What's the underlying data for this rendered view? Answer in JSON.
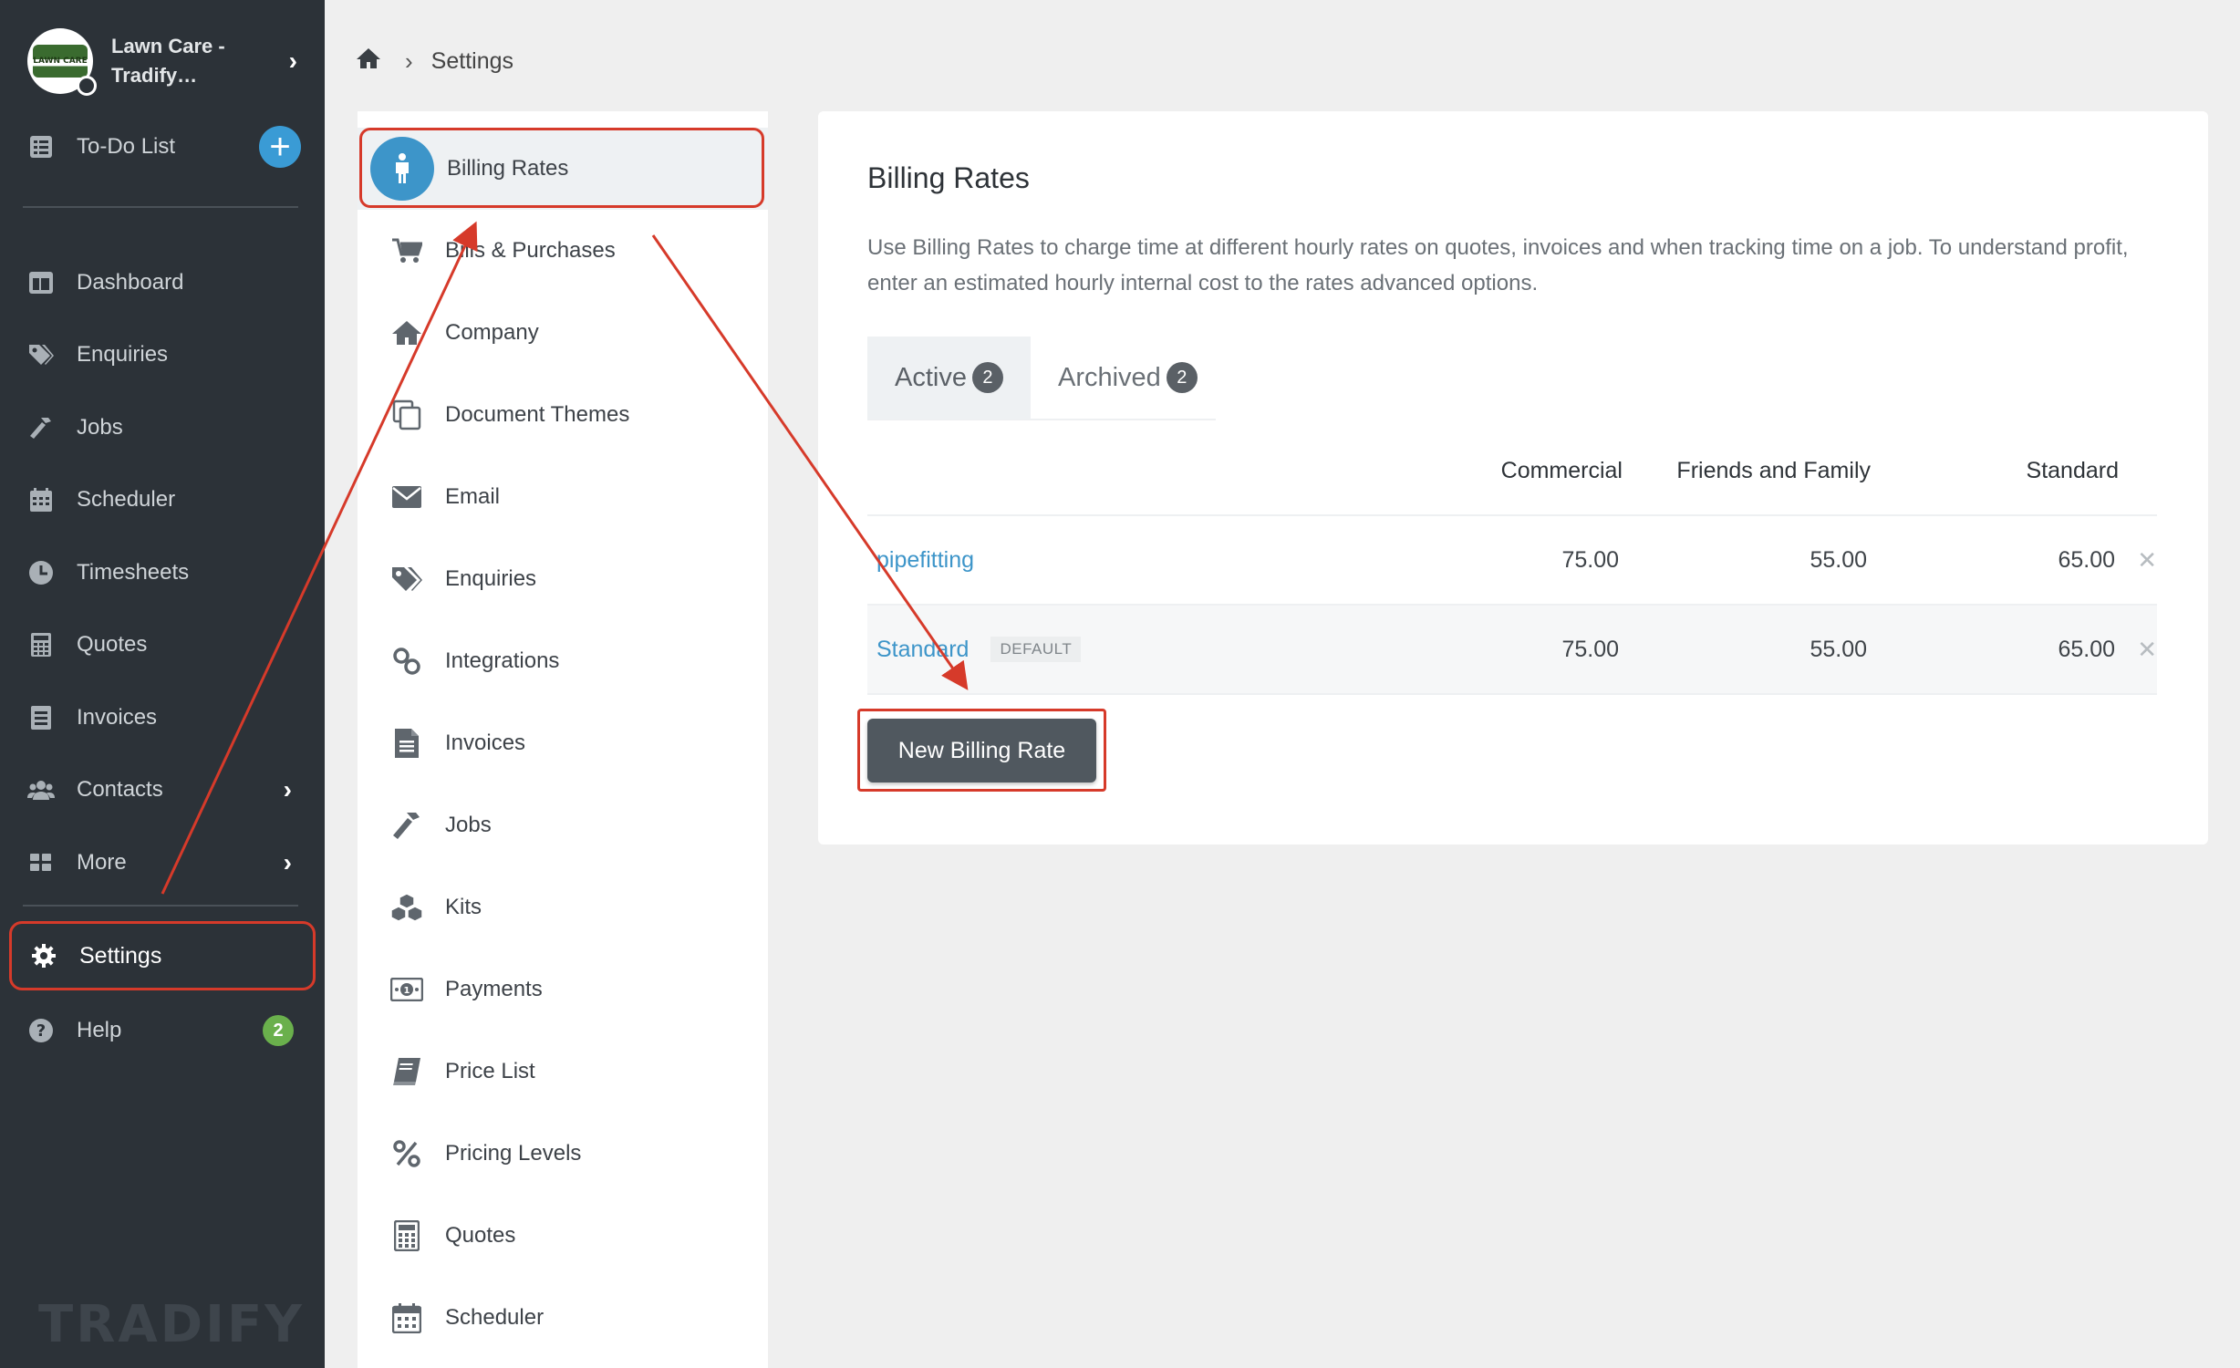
{
  "sidebar": {
    "org_name": "Lawn Care - Tradify…",
    "org_logo_text": "LAWN CARE",
    "todo_label": "To-Do List",
    "items": [
      {
        "label": "Dashboard",
        "icon": "dashboard-icon"
      },
      {
        "label": "Enquiries",
        "icon": "tags-icon"
      },
      {
        "label": "Jobs",
        "icon": "hammer-icon"
      },
      {
        "label": "Scheduler",
        "icon": "calendar-icon"
      },
      {
        "label": "Timesheets",
        "icon": "clock-icon"
      },
      {
        "label": "Quotes",
        "icon": "calculator-icon"
      },
      {
        "label": "Invoices",
        "icon": "invoice-icon"
      },
      {
        "label": "Contacts",
        "icon": "users-icon"
      },
      {
        "label": "More",
        "icon": "grid-icon"
      }
    ],
    "settings_label": "Settings",
    "help_label": "Help",
    "help_badge": "2",
    "brand": "TRADIFY"
  },
  "breadcrumb": {
    "current": "Settings"
  },
  "settings_menu": {
    "items": [
      {
        "label": "Billing Rates",
        "icon": "person-icon",
        "active": true
      },
      {
        "label": "Bills & Purchases",
        "icon": "cart-icon"
      },
      {
        "label": "Company",
        "icon": "home-icon"
      },
      {
        "label": "Document Themes",
        "icon": "copy-icon"
      },
      {
        "label": "Email",
        "icon": "envelope-icon"
      },
      {
        "label": "Enquiries",
        "icon": "tags-icon"
      },
      {
        "label": "Integrations",
        "icon": "link-icon"
      },
      {
        "label": "Invoices",
        "icon": "file-icon"
      },
      {
        "label": "Jobs",
        "icon": "hammer-icon"
      },
      {
        "label": "Kits",
        "icon": "cubes-icon"
      },
      {
        "label": "Payments",
        "icon": "money-icon"
      },
      {
        "label": "Price List",
        "icon": "book-icon"
      },
      {
        "label": "Pricing Levels",
        "icon": "percent-icon"
      },
      {
        "label": "Quotes",
        "icon": "calculator-icon"
      },
      {
        "label": "Scheduler",
        "icon": "calendar-icon"
      }
    ]
  },
  "main": {
    "title": "Billing Rates",
    "description": "Use Billing Rates to charge time at different hourly rates on quotes, invoices and when tracking time on a job. To understand profit, enter an estimated hourly internal cost to the rates advanced options.",
    "tabs": [
      {
        "label": "Active",
        "count": "2"
      },
      {
        "label": "Archived",
        "count": "2"
      }
    ],
    "columns": [
      "Commercial",
      "Friends and Family",
      "Standard"
    ],
    "rows": [
      {
        "name": "pipefitting",
        "tag": "",
        "values": [
          "75.00",
          "55.00",
          "65.00"
        ]
      },
      {
        "name": "Standard",
        "tag": "DEFAULT",
        "values": [
          "75.00",
          "55.00",
          "65.00"
        ]
      }
    ],
    "new_button": "New Billing Rate",
    "remove_glyph": "✕"
  },
  "colors": {
    "sidebar_bg": "#2c3238",
    "accent": "#3d95c9",
    "annotation": "#d63a2a",
    "badge_green": "#6ab04c"
  }
}
